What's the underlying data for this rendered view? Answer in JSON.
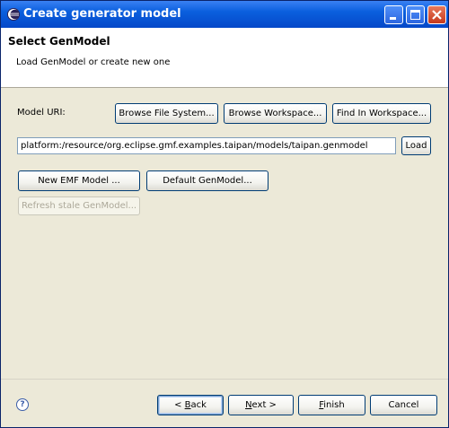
{
  "window": {
    "title": "Create generator model"
  },
  "header": {
    "title": "Select GenModel",
    "description": "Load GenModel or create new one"
  },
  "model_uri": {
    "label": "Model URI:",
    "browse_file_system": "Browse File System...",
    "browse_workspace": "Browse Workspace...",
    "find_in_workspace": "Find In Workspace...",
    "value": "platform:/resource/org.eclipse.gmf.examples.taipan/models/taipan.genmodel",
    "load": "Load"
  },
  "actions": {
    "new_emf_model": "New EMF Model ...",
    "default_genmodel": "Default GenModel...",
    "refresh_stale": "Refresh stale GenModel..."
  },
  "footer": {
    "help_glyph": "?",
    "back_mnemonic": "B",
    "back_rest": "ack",
    "back_prefix": "< ",
    "next_mnemonic": "N",
    "next_rest": "ext >",
    "finish_mnemonic": "F",
    "finish_rest": "inish",
    "cancel": "Cancel"
  },
  "icons": {
    "app": "eclipse-icon",
    "help": "help-icon"
  },
  "colors": {
    "titlebar": "#0a5fde",
    "window_bg": "#ece9d8",
    "close_button": "#c5391c"
  }
}
